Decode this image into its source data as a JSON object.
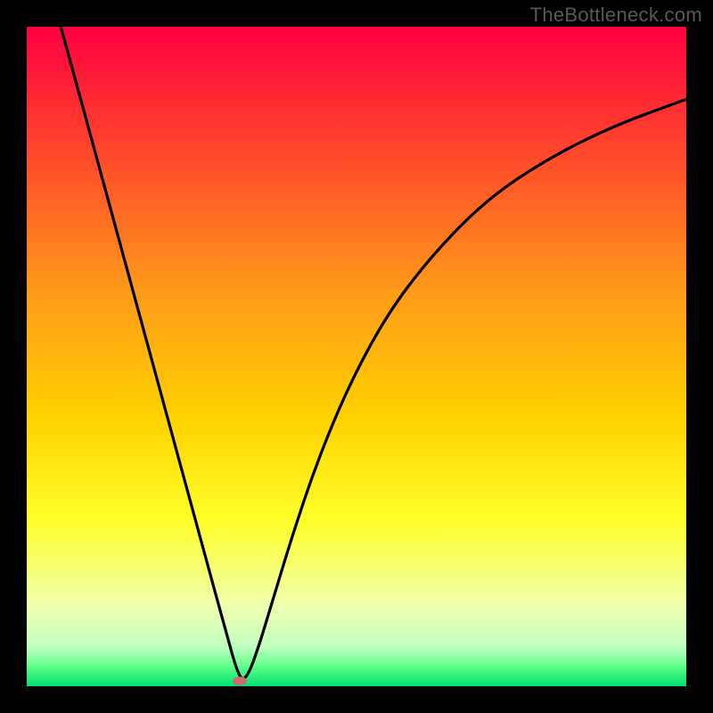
{
  "watermark": "TheBottleneck.com",
  "chart_data": {
    "type": "line",
    "title": "",
    "xlabel": "",
    "ylabel": "",
    "xlim": [
      0,
      100
    ],
    "ylim": [
      0,
      100
    ],
    "background_gradient": {
      "stops": [
        {
          "offset": 0.0,
          "color": "#ff0040"
        },
        {
          "offset": 0.2,
          "color": "#ff4b2a"
        },
        {
          "offset": 0.4,
          "color": "#ff9a1a"
        },
        {
          "offset": 0.6,
          "color": "#ffd400"
        },
        {
          "offset": 0.75,
          "color": "#ffff2a"
        },
        {
          "offset": 0.88,
          "color": "#f0ffb0"
        },
        {
          "offset": 0.94,
          "color": "#c0ffc0"
        },
        {
          "offset": 0.97,
          "color": "#5fff8a"
        },
        {
          "offset": 1.0,
          "color": "#00e070"
        }
      ]
    },
    "series": [
      {
        "name": "bottleneck-curve",
        "x": [
          3.5,
          6,
          9,
          12,
          15,
          18,
          21,
          24,
          27,
          30,
          32.3,
          33.5,
          35,
          37,
          40,
          44,
          49,
          55,
          62,
          70,
          79,
          89,
          100
        ],
        "y": [
          106,
          97,
          86,
          75,
          64,
          53,
          42,
          31,
          20,
          9,
          0.8,
          1.5,
          5.5,
          12,
          22,
          34,
          46,
          57,
          66,
          74,
          80,
          85,
          89
        ]
      }
    ],
    "marker": {
      "x": 32.3,
      "y": 0.8,
      "color": "#cc6b6e"
    },
    "curve_color": "#000000",
    "frame_color": "#000000"
  }
}
